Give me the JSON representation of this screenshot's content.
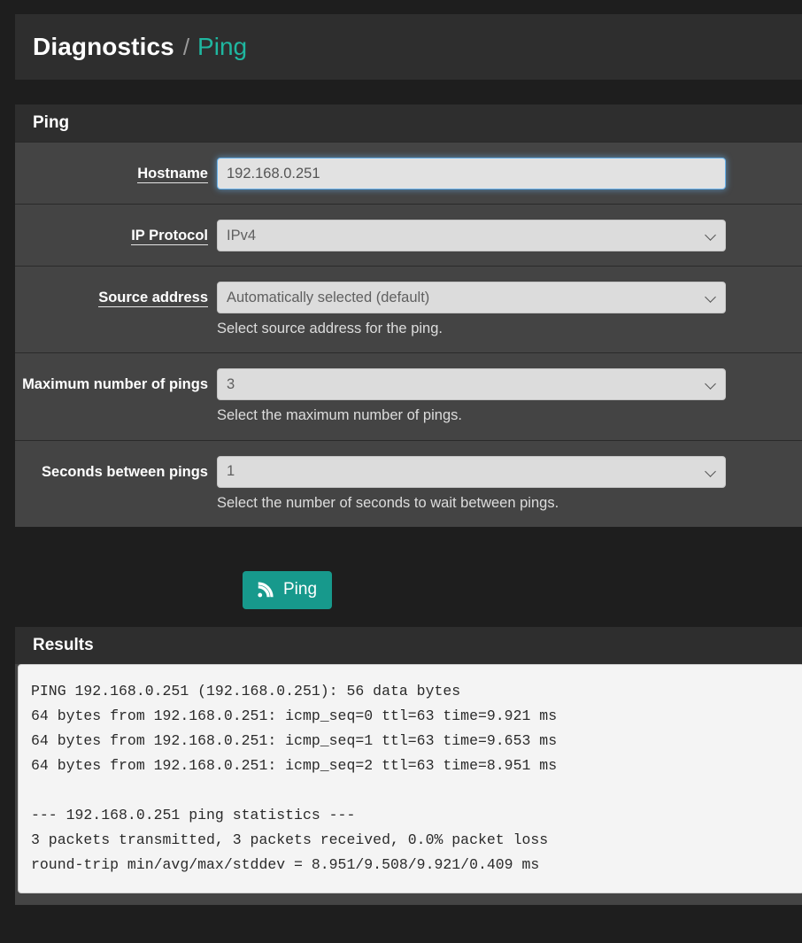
{
  "breadcrumb": {
    "root": "Diagnostics",
    "separator": "/",
    "current": "Ping"
  },
  "ping_panel": {
    "title": "Ping",
    "fields": [
      {
        "label": "Hostname",
        "underlined": true,
        "control": "text",
        "value": "192.168.0.251",
        "placeholder": "Hostname",
        "help": ""
      },
      {
        "label": "IP Protocol",
        "underlined": true,
        "control": "select",
        "value": "IPv4",
        "help": ""
      },
      {
        "label": "Source address",
        "underlined": true,
        "control": "select",
        "value": "Automatically selected (default)",
        "help": "Select source address for the ping."
      },
      {
        "label": "Maximum number of pings",
        "underlined": false,
        "control": "select",
        "value": "3",
        "help": "Select the maximum number of pings."
      },
      {
        "label": "Seconds between pings",
        "underlined": false,
        "control": "select",
        "value": "1",
        "help": "Select the number of seconds to wait between pings."
      }
    ]
  },
  "actions": {
    "ping_button_label": "Ping",
    "ping_button_icon": "rss-signal-icon",
    "ping_button_color": "#17998c"
  },
  "results_panel": {
    "title": "Results",
    "output": "PING 192.168.0.251 (192.168.0.251): 56 data bytes\n64 bytes from 192.168.0.251: icmp_seq=0 ttl=63 time=9.921 ms\n64 bytes from 192.168.0.251: icmp_seq=1 ttl=63 time=9.653 ms\n64 bytes from 192.168.0.251: icmp_seq=2 ttl=63 time=8.951 ms\n\n--- 192.168.0.251 ping statistics ---\n3 packets transmitted, 3 packets received, 0.0% packet loss\nround-trip min/avg/max/stddev = 8.951/9.508/9.921/0.409 ms"
  },
  "theme": {
    "page_background": "#1e1e1e",
    "panel_header": "#2e2e2e",
    "panel_body": "#444444",
    "accent": "#1fb7a0",
    "focus_border": "#66afe9"
  }
}
